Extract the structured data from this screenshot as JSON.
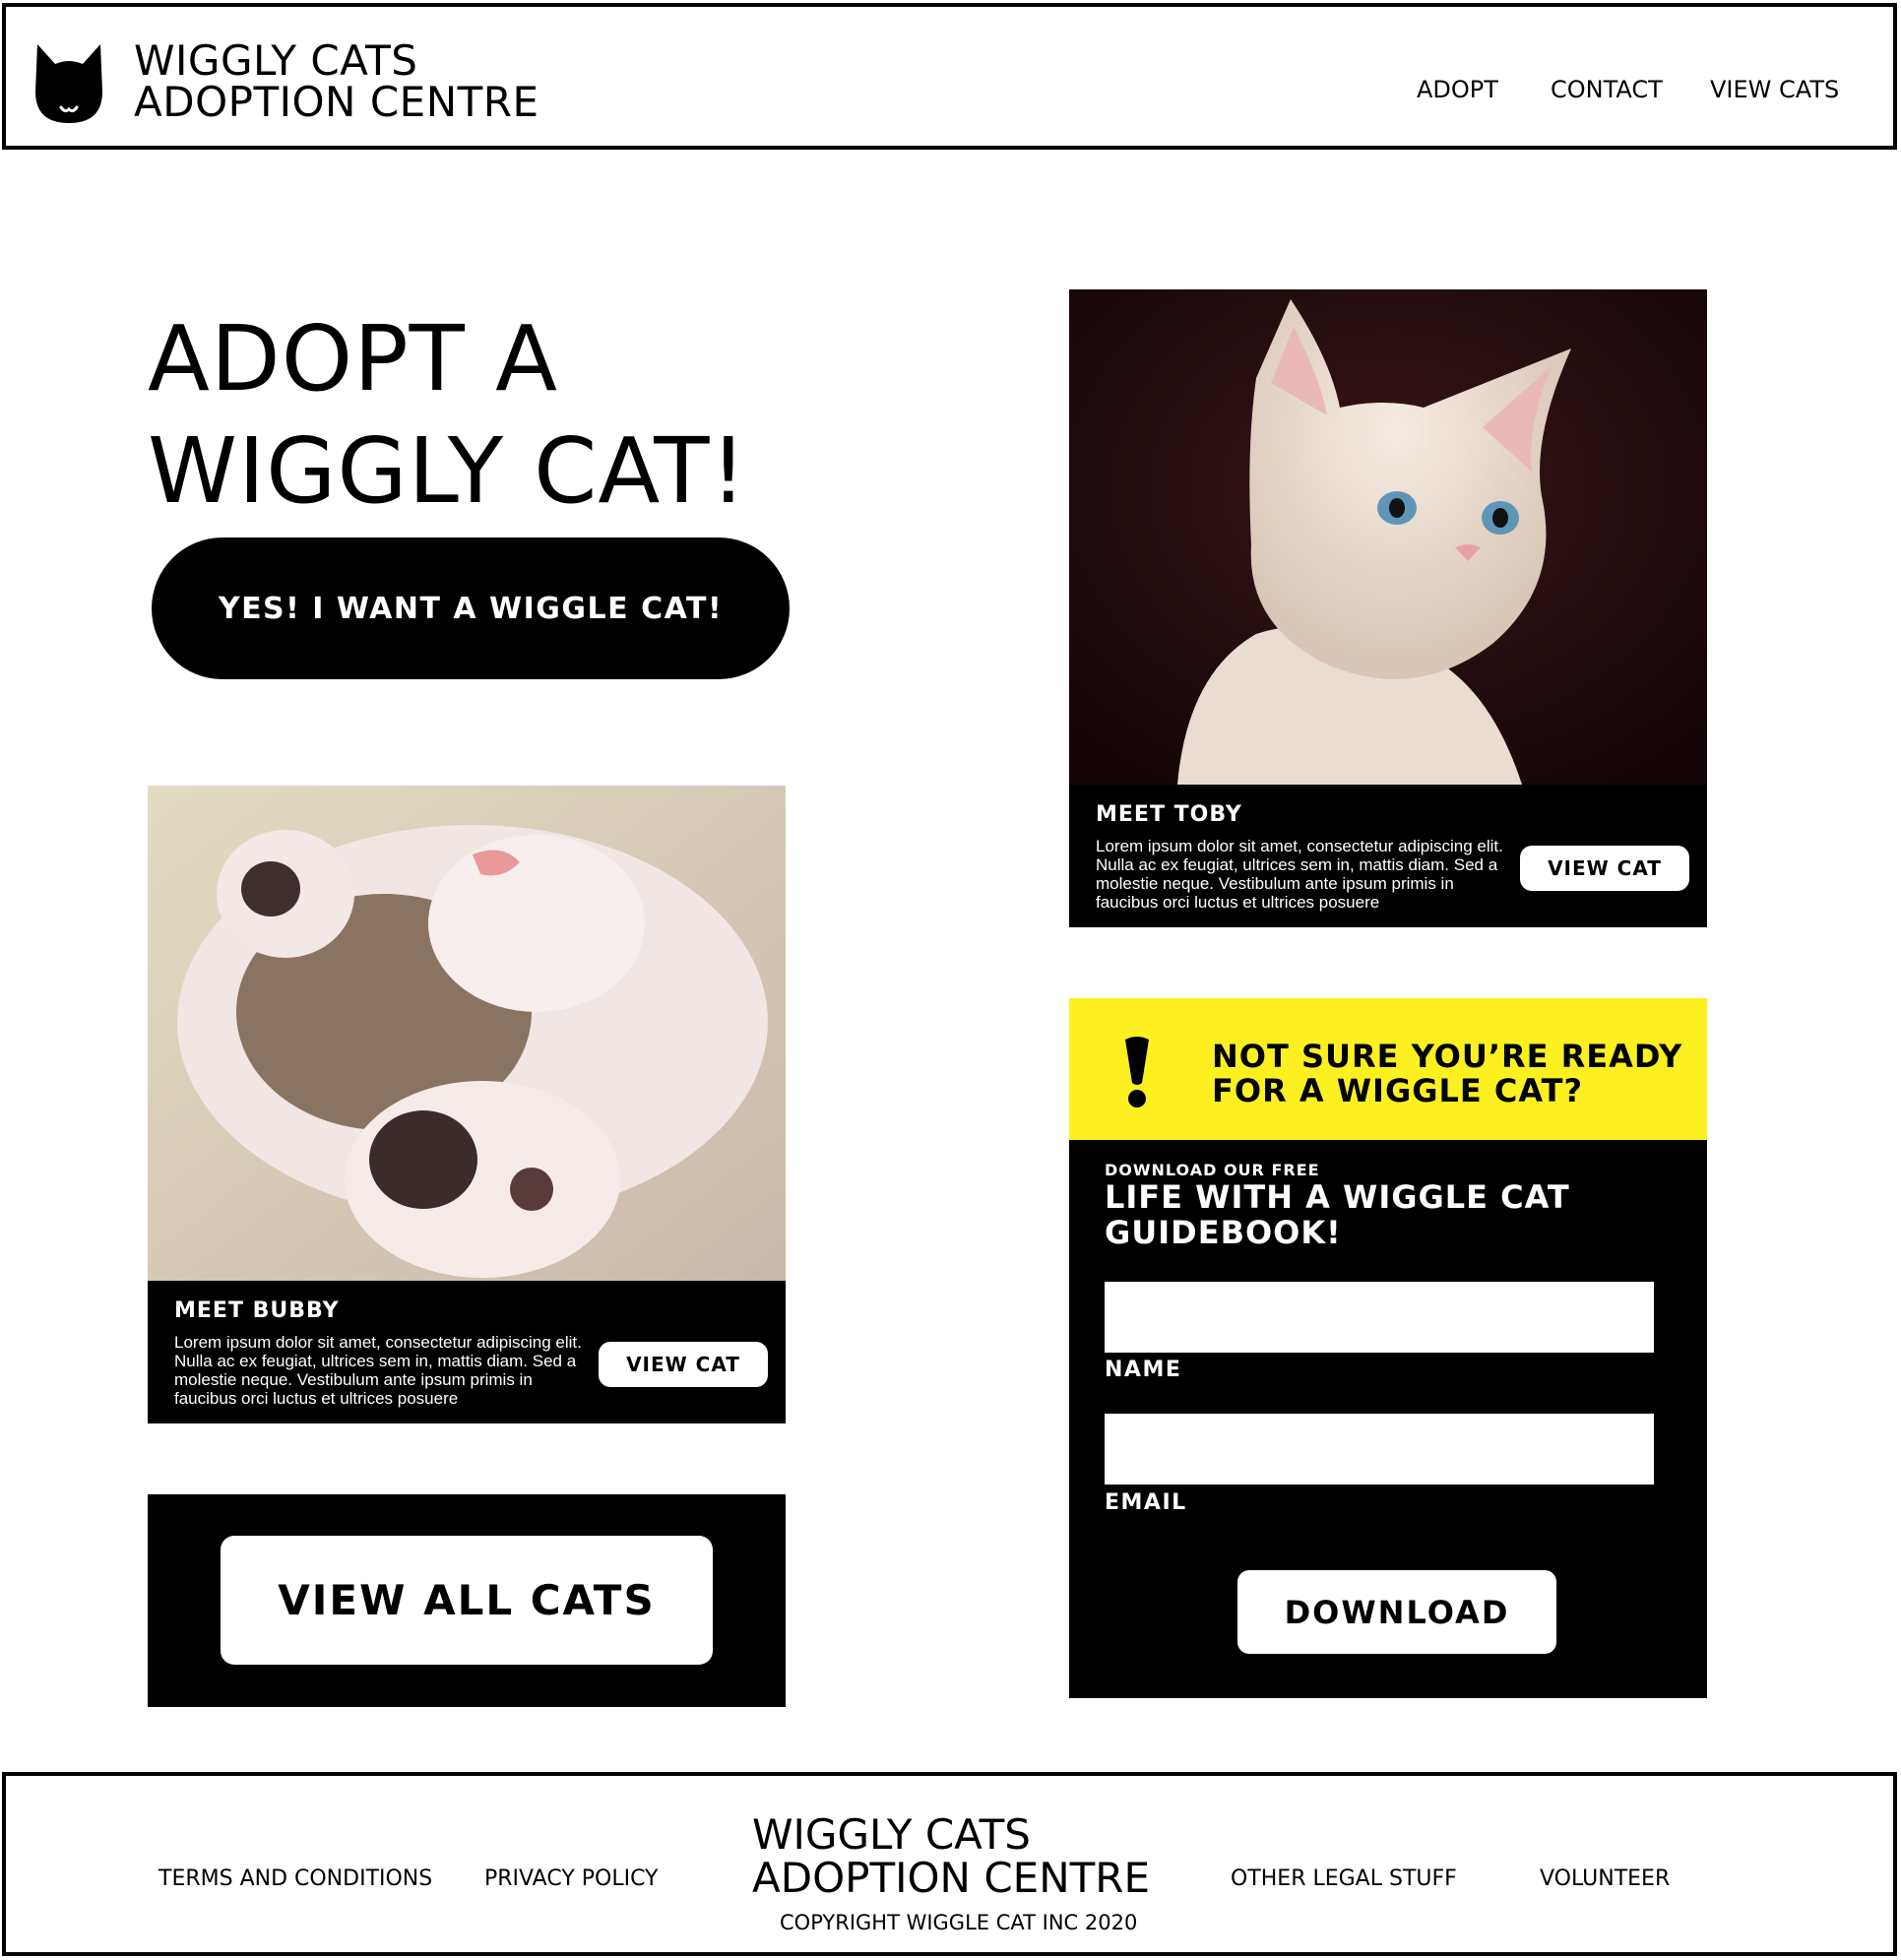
{
  "header": {
    "logo_line1": "WIGGLY CATS",
    "logo_line2": "ADOPTION CENTRE",
    "nav": [
      "ADOPT",
      "CONTACT",
      "VIEW CATS"
    ]
  },
  "hero": {
    "title_line1": "ADOPT A",
    "title_line2": "WIGGLY CAT!",
    "cta_label": "YES! I WANT A WIGGLE CAT!"
  },
  "cards": {
    "toby": {
      "title": "MEET TOBY",
      "text": "Lorem ipsum dolor sit amet, consectetur adipiscing elit. Nulla ac ex feugiat, ultrices sem in, mattis diam. Sed a molestie neque. Vestibulum ante ipsum primis in faucibus orci luctus et ultrices posuere",
      "button": "VIEW CAT"
    },
    "bubby": {
      "title": "MEET BUBBY",
      "text": "Lorem ipsum dolor sit amet, consectetur adipiscing elit. Nulla ac ex feugiat, ultrices sem in, mattis diam. Sed a molestie neque. Vestibulum ante ipsum primis in faucibus orci luctus et ultrices posuere",
      "button": "VIEW CAT"
    }
  },
  "view_all": {
    "label": "VIEW ALL CATS"
  },
  "guide": {
    "question_line1": "NOT SURE YOU’RE READY",
    "question_line2": "FOR A WIGGLE CAT?",
    "subtitle": "DOWNLOAD OUR FREE",
    "title_line1": "LIFE WITH A WIGGLE CAT",
    "title_line2": "GUIDEBOOK!",
    "name_label": "NAME",
    "name_value": "",
    "email_label": "EMAIL",
    "email_value": "",
    "download_label": "DOWNLOAD",
    "accent_color": "#fdf021"
  },
  "footer": {
    "links_left": [
      "TERMS AND CONDITIONS",
      "PRIVACY POLICY"
    ],
    "links_right": [
      "OTHER LEGAL STUFF",
      "VOLUNTEER"
    ],
    "logo_line1": "WIGGLY CATS",
    "logo_line2": "ADOPTION CENTRE",
    "copyright": "COPYRIGHT WIGGLE CAT INC 2020"
  },
  "icons": {
    "logo": "cat-head-icon",
    "alert": "exclamation-icon"
  }
}
